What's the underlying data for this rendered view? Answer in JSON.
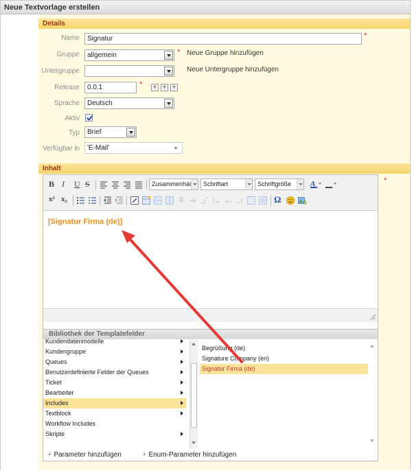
{
  "window": {
    "title": "Neue Textvorlage erstellen"
  },
  "details": {
    "section_title": "Details",
    "name": {
      "label": "Name",
      "value": "Signatur"
    },
    "gruppe": {
      "label": "Gruppe",
      "value": "allgemein",
      "link": "Neue Gruppe hinzufügen"
    },
    "untergruppe": {
      "label": "Untergruppe",
      "value": "",
      "link": "Neue Untergruppe hinzufügen"
    },
    "release": {
      "label": "Release",
      "value": "0.0.1"
    },
    "sprache": {
      "label": "Sprache",
      "value": "Deutsch"
    },
    "aktiv": {
      "label": "Aktiv",
      "checked": true
    },
    "typ": {
      "label": "Typ",
      "value": "Brief"
    },
    "verfuegbar": {
      "label": "Verfügbar in",
      "value": "'E-Mail'"
    }
  },
  "inhalt": {
    "section_title": "Inhalt",
    "toolbar": {
      "bold": "B",
      "italic": "I",
      "underline": "U",
      "strike": "S",
      "format_combo": "Zusammenhän",
      "font_combo": "Schriftart",
      "size_combo": "Schriftgröße",
      "superscript": "x²",
      "subscript": "x₂",
      "special_char": "Ω"
    },
    "content": "[Signatur Firma (de)]"
  },
  "library": {
    "title": "Bibliothek der Templatefelder",
    "left_items": [
      {
        "label": "Kundendatenmodelle",
        "caret": true
      },
      {
        "label": "Kundengruppe",
        "caret": true
      },
      {
        "label": "Queues",
        "caret": true
      },
      {
        "label": "Benutzerdefinierte Felder der Queues",
        "caret": true
      },
      {
        "label": "Ticket",
        "caret": true
      },
      {
        "label": "Bearbeiter",
        "caret": true
      },
      {
        "label": "Includes",
        "caret": true,
        "selected": true
      },
      {
        "label": "Textblock",
        "caret": true
      },
      {
        "label": "Workflow Includes",
        "caret": false
      },
      {
        "label": "Skripte",
        "caret": true
      }
    ],
    "right_items": [
      {
        "label": "Begrüßung (de)"
      },
      {
        "label": "Signature Company (en)"
      },
      {
        "label": "Signatur Firma (de)",
        "selected": true
      }
    ],
    "add_param": "Parameter hinzufügen",
    "add_enum_param": "Enum-Parameter hinzufügen"
  },
  "colors": {
    "accent": "#f7d36b",
    "section_text": "#9a3412",
    "content_text": "#e8901c",
    "arrow": "#e53935"
  }
}
